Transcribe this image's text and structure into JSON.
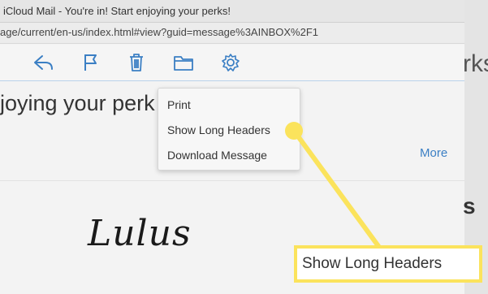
{
  "window": {
    "title": "iCloud Mail - You're in! Start enjoying your perks!",
    "url": "age/current/en-us/index.html#view?guid=message%3AINBOX%2F1"
  },
  "toolbar": {
    "icons": [
      "reply-icon",
      "flag-icon",
      "trash-icon",
      "folder-icon",
      "gear-icon"
    ]
  },
  "message": {
    "subject_fragment": "joying your perk",
    "more_label": "More",
    "logo_text": "Lulus",
    "right_fragment_top": "rks!",
    "right_fragment_bottom": "s"
  },
  "menu": {
    "items": [
      "Print",
      "Show Long Headers",
      "Download Message"
    ]
  },
  "callout": {
    "label": "Show Long Headers",
    "color": "#fbe35c"
  },
  "colors": {
    "accent": "#3b7fc4",
    "highlight": "#fbe35c"
  }
}
